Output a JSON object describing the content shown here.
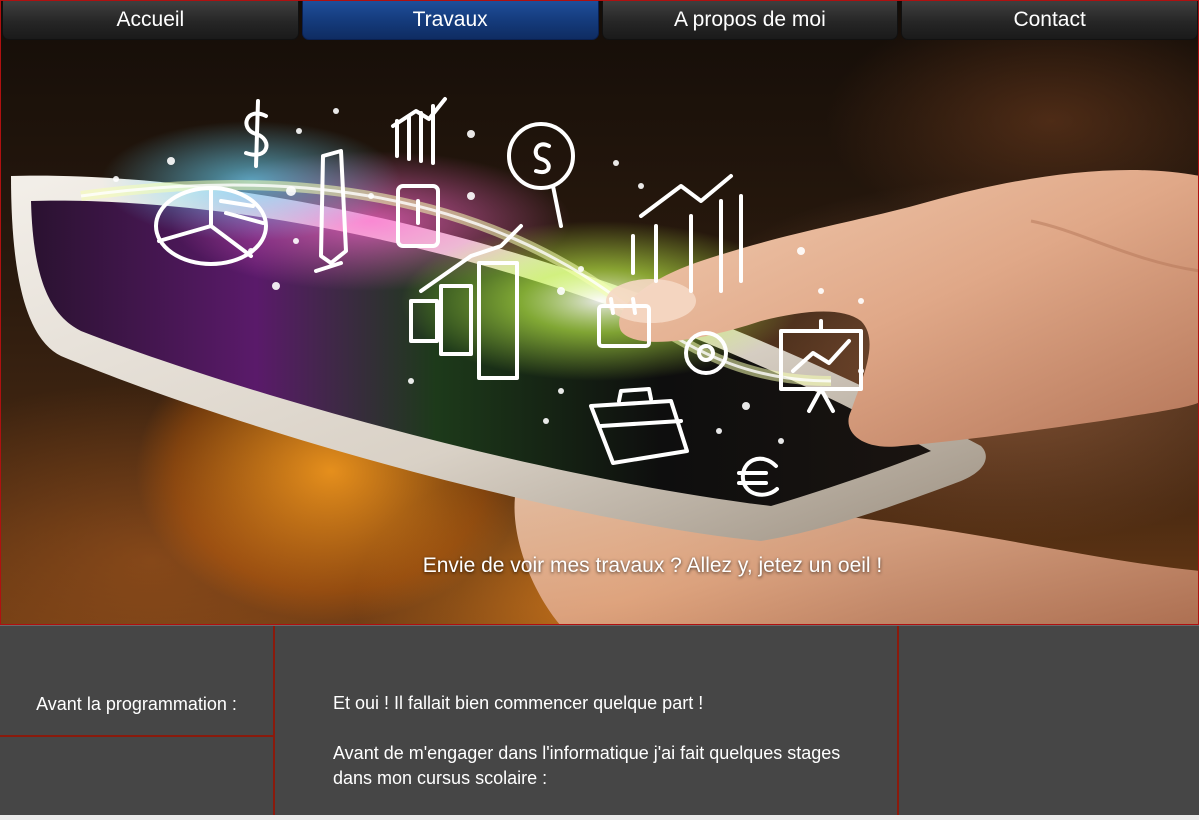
{
  "nav": {
    "items": [
      {
        "label": "Accueil",
        "active": false
      },
      {
        "label": "Travaux",
        "active": true
      },
      {
        "label": "A propos de moi",
        "active": false
      },
      {
        "label": "Contact",
        "active": false
      }
    ],
    "active_color": "#143a7a",
    "item_color": "#262626"
  },
  "hero": {
    "caption": "Envie de voir mes travaux ? Allez y, jetez un oeil !",
    "image_subject": "hand touching tablet with glowing business doodle icons",
    "icons": [
      "dollar-icon",
      "bar-chart-icon",
      "magnifier-dollar-icon",
      "pie-chart-icon",
      "pen-icon",
      "phone-icon",
      "growth-chart-icon",
      "calendar-icon",
      "at-sign-icon",
      "presentation-board-icon",
      "briefcase-icon",
      "euro-icon"
    ]
  },
  "content": {
    "left_label": "Avant la programmation :",
    "paragraphs": [
      "Et oui ! Il fallait bien commencer quelque part !",
      "Avant de m'engager dans l'informatique j'ai fait quelques stages dans mon cursus scolaire :"
    ],
    "border_color": "#8a1a0c",
    "background": "#464646"
  }
}
